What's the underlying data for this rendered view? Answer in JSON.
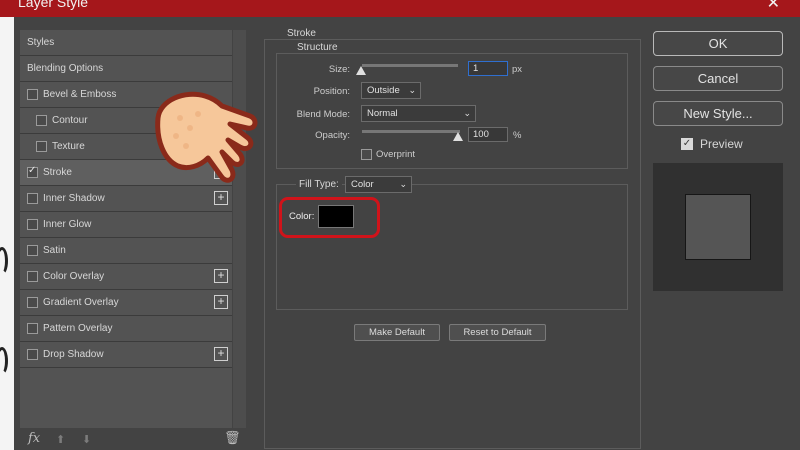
{
  "window": {
    "title": "Layer Style",
    "close_glyph": "✕"
  },
  "styles_panel": {
    "items": [
      {
        "label": "Styles",
        "checkbox": false,
        "checked": false,
        "plus": false,
        "indent": false
      },
      {
        "label": "Blending Options",
        "checkbox": false,
        "checked": false,
        "plus": false,
        "indent": false
      },
      {
        "label": "Bevel & Emboss",
        "checkbox": true,
        "checked": false,
        "plus": false,
        "indent": false
      },
      {
        "label": "Contour",
        "checkbox": true,
        "checked": false,
        "plus": false,
        "indent": true
      },
      {
        "label": "Texture",
        "checkbox": true,
        "checked": false,
        "plus": false,
        "indent": true
      },
      {
        "label": "Stroke",
        "checkbox": true,
        "checked": true,
        "plus": true,
        "indent": false,
        "active": true
      },
      {
        "label": "Inner Shadow",
        "checkbox": true,
        "checked": false,
        "plus": true,
        "indent": false
      },
      {
        "label": "Inner Glow",
        "checkbox": true,
        "checked": false,
        "plus": false,
        "indent": false
      },
      {
        "label": "Satin",
        "checkbox": true,
        "checked": false,
        "plus": false,
        "indent": false
      },
      {
        "label": "Color Overlay",
        "checkbox": true,
        "checked": false,
        "plus": true,
        "indent": false
      },
      {
        "label": "Gradient Overlay",
        "checkbox": true,
        "checked": false,
        "plus": true,
        "indent": false
      },
      {
        "label": "Pattern Overlay",
        "checkbox": true,
        "checked": false,
        "plus": false,
        "indent": false
      },
      {
        "label": "Drop Shadow",
        "checkbox": true,
        "checked": false,
        "plus": true,
        "indent": false
      }
    ],
    "footer": {
      "fx_label": "fx",
      "up_icon": "arrow-up-icon",
      "down_icon": "arrow-down-icon",
      "trash_icon": "trash-icon"
    }
  },
  "stroke": {
    "section_title": "Stroke",
    "structure_title": "Structure",
    "size_label": "Size:",
    "size_value": "1",
    "size_unit": "px",
    "position_label": "Position:",
    "position_value": "Outside",
    "blend_mode_label": "Blend Mode:",
    "blend_mode_value": "Normal",
    "opacity_label": "Opacity:",
    "opacity_value": "100",
    "opacity_unit": "%",
    "overprint_label": "Overprint",
    "fill_type_label": "Fill Type:",
    "fill_type_value": "Color",
    "color_label": "Color:",
    "color_value": "#000000",
    "make_default_label": "Make Default",
    "reset_default_label": "Reset to Default"
  },
  "actions": {
    "ok_label": "OK",
    "cancel_label": "Cancel",
    "new_style_label": "New Style...",
    "preview_label": "Preview",
    "preview_checked": true
  },
  "colors": {
    "title_bar": "#a5171b",
    "highlight_ring": "#d0131a",
    "hand_fill": "#f6c79a",
    "hand_outline": "#8a2a1a"
  }
}
